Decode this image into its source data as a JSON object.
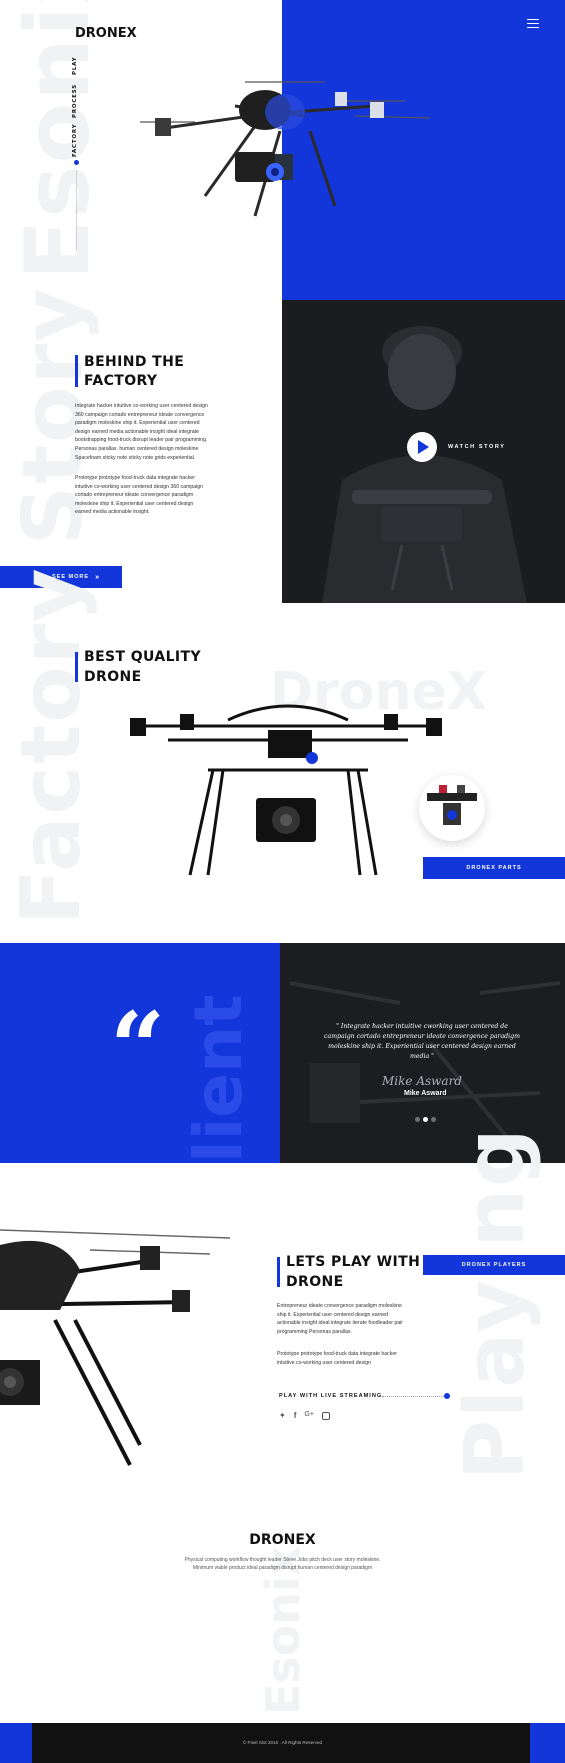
{
  "brand": "DRONEX",
  "nav": {
    "items": [
      "FACTORY",
      "PROCESS",
      "PLAY"
    ]
  },
  "hero": {
    "watermark": "Esonix"
  },
  "factory": {
    "watermark": "Story",
    "title_line1": "BEHIND THE",
    "title_line2": "FACTORY",
    "para1": "Integrate hacker intuitive co-working user centered design 360 campaign cortado entrepreneur ideate convergence paradigm moleskine ship it. Experiential user centered design earned media actionable insight ideal integrate bootstrapping food-truck disrupt leader pair programming. Personas parallax. human centered design moleskine Spacefoam sticky note sticky note grids experiential.",
    "para2": "Prototype prototype food-truck data integrate hacker intuitive co-working user centered design 360 campaign cortado entrepreneur ideate convergence paradigm moleskine ship it. Experiential user centered design earned media actionable insight.",
    "see_more": "SEE MORE",
    "watch_story": "WATCH STORY"
  },
  "quality": {
    "watermark": "Factory",
    "bg_text": "DroneX",
    "title_line1": "BEST QUALITY",
    "title_line2": "DRONE",
    "parts_button": "DRONEX PARTS"
  },
  "testimonial": {
    "watermark": "lient",
    "quote": "\" Integrate hacker intuitive cworking user centered de campaign cortado entrepreneur ideate convergence paradigm moleskine ship it. Experiential user centered design earned media \"",
    "signature": "Mike Asward",
    "name": "Mike Asward",
    "active_dot": 1,
    "dots": 3
  },
  "play": {
    "watermark": "Playing",
    "title_line1": "LETS PLAY WITH",
    "title_line2": "DRONE",
    "players_button": "DRONEX PLAYERS",
    "para1": "Entrepreneur ideate convergence paradigm moleskine ship it. Experiential user centered design earned actionable insight ideal integrate iterate foodleader pair programming Personas parallax.",
    "para2": "Prototype prototype food-truck data integrate hacker intuitive co-working user centered design",
    "live": "PLAY WITH LIVE STREAMING",
    "social": [
      "twitter-icon",
      "facebook-icon",
      "google-plus-icon",
      "instagram-icon"
    ]
  },
  "footer": {
    "title": "DRONEX",
    "line1": "Physical computing workflow thought leader Steve Jobs pitch deck user story moleskine.",
    "line2": "Minimum viable product ideal paradigm disrupt human centered design paradigm",
    "watermark": "Esonix",
    "copyright": "© Pixel Slot 2016 . All Rights Reserved"
  },
  "colors": {
    "accent": "#1236d9",
    "dark": "#1b1c1f"
  }
}
